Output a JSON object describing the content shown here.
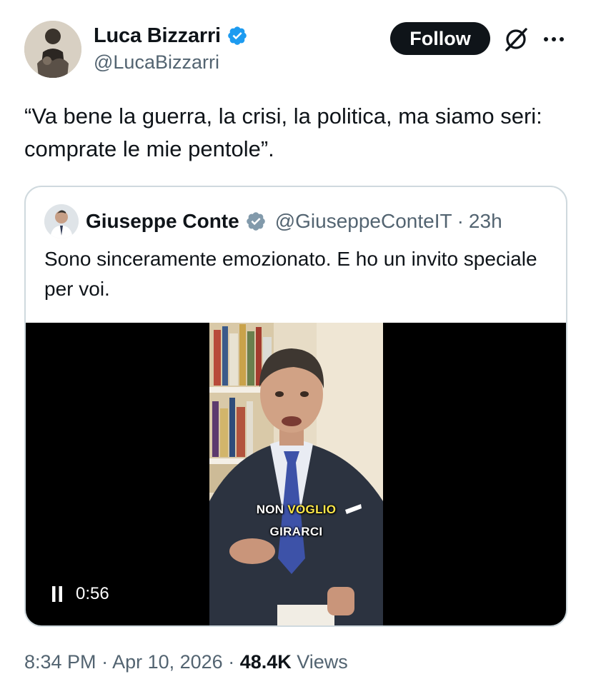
{
  "author": {
    "name": "Luca Bizzarri",
    "handle": "@LucaBizzarri",
    "verified": true
  },
  "actions": {
    "follow_label": "Follow",
    "grok_icon": "grok-icon",
    "more_icon": "more-icon"
  },
  "tweet": {
    "text": "“Va bene la guerra, la crisi, la politica, ma siamo seri: comprate le mie pentole”."
  },
  "quote": {
    "name": "Giuseppe Conte",
    "handle": "@GiuseppeConteIT",
    "separator": "·",
    "time": "23h",
    "text": "Sono sinceramente emozionato. E ho un invito speciale per voi.",
    "video": {
      "caption_line1_a": "NON ",
      "caption_line1_b": "VOGLIO",
      "caption_line2": "GIRARCI",
      "duration": "0:56",
      "state": "playing"
    }
  },
  "footer": {
    "time": "8:34 PM",
    "sep1": " · ",
    "date": "Apr 10, 2026",
    "sep2": " · ",
    "views_count": "48.4K",
    "views_label": " Views"
  },
  "colors": {
    "text": "#0f1419",
    "secondary": "#536471",
    "verified_blue": "#1d9bf0",
    "verified_gray": "#829aab",
    "border": "#cfd9de",
    "caption_highlight": "#ffe94a"
  }
}
